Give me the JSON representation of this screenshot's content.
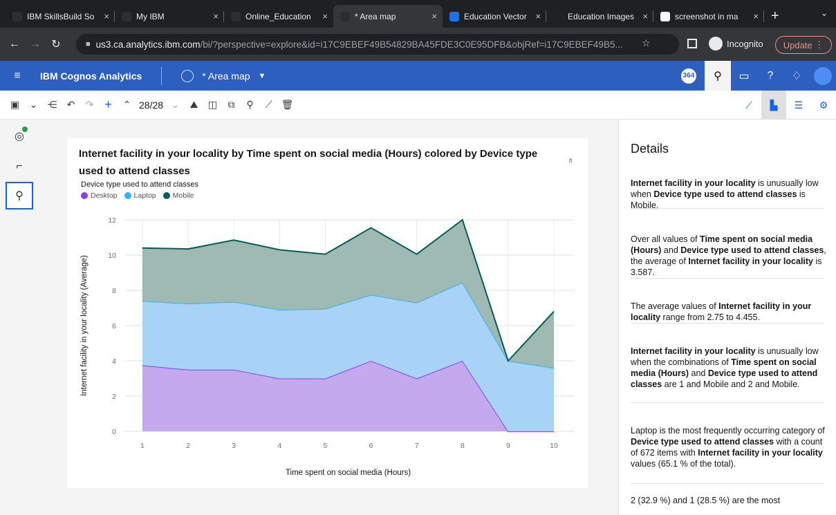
{
  "browser": {
    "tabs": [
      {
        "title": "IBM SkillsBuild So",
        "color": "#2d2e30"
      },
      {
        "title": "My IBM",
        "color": "#2d2e30"
      },
      {
        "title": "Online_Education",
        "color": "#2d2e30"
      },
      {
        "title": "* Area map",
        "color": "#2d2e30"
      },
      {
        "title": "Education Vector",
        "color": "#1a73e8"
      },
      {
        "title": "Education Images",
        "color": "#202124"
      },
      {
        "title": "screenshot in ma",
        "color": "#ffffff"
      }
    ],
    "new_tab": "+",
    "tab_menu": "⌄",
    "url_host": "us3.ca.analytics.ibm.com",
    "url_rest": "/bi/?perspective=explore&id=i17C9EBEF49B54829BA45FDE3C0E95DFB&objRef=i17C9EBEF49B5...",
    "incognito_label": "Incognito",
    "update_label": "Update"
  },
  "app": {
    "brand": "IBM Cognos Analytics",
    "view_name": "* Area map",
    "notification_count": "364"
  },
  "toolbar": {
    "page_counter": "28/28"
  },
  "chart_data": {
    "type": "area",
    "title": "Internet facility in your locality by Time spent on social media (Hours) colored by Device type used to attend classes",
    "legend_title": "Device type used to attend classes",
    "xlabel": "Time spent on social media (Hours)",
    "ylabel": "Internet facility in your locality (Average)",
    "stacked": true,
    "x": [
      1,
      2,
      3,
      4,
      5,
      6,
      7,
      8,
      9,
      10
    ],
    "yticks": [
      0,
      2,
      4,
      6,
      8,
      10,
      12
    ],
    "ylim": [
      0,
      12
    ],
    "series": [
      {
        "name": "Desktop",
        "color": "#8a3ffc",
        "fill": "#c5a9ee",
        "values": [
          3.75,
          3.5,
          3.5,
          3.0,
          3.0,
          4.0,
          3.0,
          4.0,
          0,
          0
        ]
      },
      {
        "name": "Laptop",
        "color": "#33b1ff",
        "fill": "#a9d2f7",
        "values": [
          3.65,
          3.75,
          3.85,
          3.9,
          3.95,
          3.75,
          4.3,
          4.45,
          4.0,
          3.6
        ]
      },
      {
        "name": "Mobile",
        "color": "#005d5d",
        "fill": "#9fb9b3",
        "values": [
          3.0,
          3.1,
          3.5,
          3.4,
          3.1,
          3.8,
          2.75,
          3.55,
          0,
          3.2
        ]
      }
    ],
    "grid": true
  },
  "details": {
    "heading": "Details",
    "insights": [
      [
        {
          "t": "Internet facility in your locality",
          "b": true
        },
        {
          "t": " is unusually low when ",
          "b": false
        },
        {
          "t": "Device type used to attend classes",
          "b": true
        },
        {
          "t": " is Mobile.",
          "b": false
        }
      ],
      [
        {
          "t": "Over all values of ",
          "b": false
        },
        {
          "t": "Time spent on social media (Hours)",
          "b": true
        },
        {
          "t": " and ",
          "b": false
        },
        {
          "t": "Device type used to attend classes",
          "b": true
        },
        {
          "t": ", the average of ",
          "b": false
        },
        {
          "t": "Internet facility in your locality",
          "b": true
        },
        {
          "t": " is 3.587.",
          "b": false
        }
      ],
      [
        {
          "t": "The average values of ",
          "b": false
        },
        {
          "t": "Internet facility in your locality",
          "b": true
        },
        {
          "t": " range from 2.75 to 4.455.",
          "b": false
        }
      ],
      [
        {
          "t": "Internet facility in your locality",
          "b": true
        },
        {
          "t": " is unusually low when the combinations of ",
          "b": false
        },
        {
          "t": "Time spent on social media (Hours)",
          "b": true
        },
        {
          "t": " and ",
          "b": false
        },
        {
          "t": "Device type used to attend classes",
          "b": true
        },
        {
          "t": " are 1 and Mobile and 2 and Mobile.",
          "b": false
        }
      ],
      [
        {
          "t": "Laptop is the most frequently occurring category of ",
          "b": false
        },
        {
          "t": "Device type used to attend classes",
          "b": true
        },
        {
          "t": " with a count of 672 items with ",
          "b": false
        },
        {
          "t": "Internet facility in your locality",
          "b": true
        },
        {
          "t": " values (65.1 % of the total).",
          "b": false
        }
      ],
      [
        {
          "t": "2 (32.9 %) and 1 (28.5 %) are the most",
          "b": false
        }
      ]
    ]
  }
}
